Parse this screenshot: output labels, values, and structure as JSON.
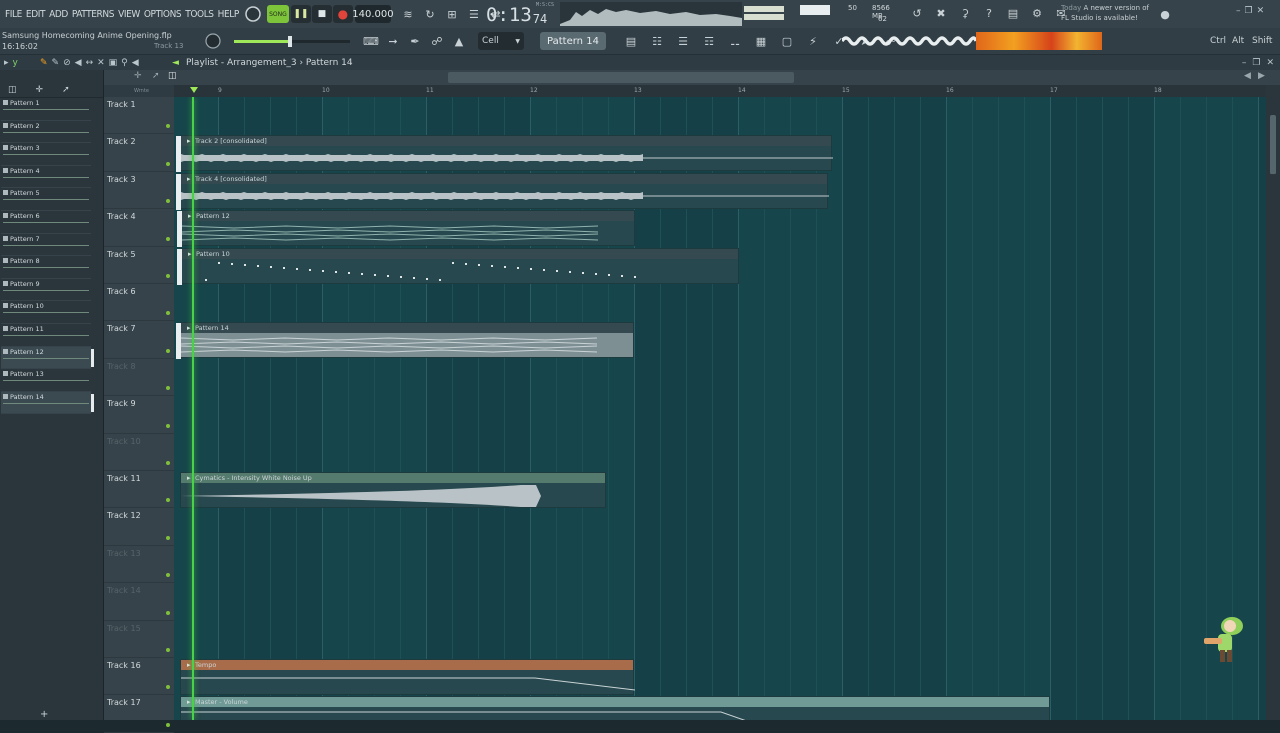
{
  "menu": [
    "FILE",
    "EDIT",
    "ADD",
    "PATTERNS",
    "VIEW",
    "OPTIONS",
    "TOOLS",
    "HELP"
  ],
  "transport": {
    "mode": "SONG",
    "tempo": "140.000"
  },
  "song": {
    "title": "Samsung Homecoming Anime Opening.flp",
    "time": "16:16:02",
    "track_hint": "Track 13"
  },
  "time": {
    "main": "0:13",
    "sub": "74",
    "unit": "M:S:CS"
  },
  "cpu": {
    "value": "50",
    "mem": "8566 MB",
    "poly": "62"
  },
  "news": {
    "today": "Today",
    "line1": "A newer version of",
    "line2": "FL Studio is available!"
  },
  "keys": {
    "ctrl": "Ctrl",
    "alt": "Alt",
    "shift": "Shift"
  },
  "snap": "Cell",
  "current_pattern": "Pattern 14",
  "breadcrumb": "Playlist - Arrangement_3 › Pattern 14",
  "ruler": [
    "9",
    "10",
    "11",
    "12",
    "13",
    "14",
    "15",
    "16",
    "17",
    "18"
  ],
  "ruler_small": "Wrnte",
  "patterns": [
    "Pattern 1",
    "Pattern 2",
    "Pattern 3",
    "Pattern 4",
    "Pattern 5",
    "Pattern 6",
    "Pattern 7",
    "Pattern 8",
    "Pattern 9",
    "Pattern 10",
    "Pattern 11",
    "Pattern 12",
    "Pattern 13",
    "Pattern 14"
  ],
  "tracks": [
    "Track 1",
    "Track 2",
    "Track 3",
    "Track 4",
    "Track 5",
    "Track 6",
    "Track 7",
    "Track 8",
    "Track 9",
    "Track 10",
    "Track 11",
    "Track 12",
    "Track 13",
    "Track 14",
    "Track 15",
    "Track 16",
    "Track 17"
  ],
  "clips": [
    "Track 2 [consolidated]",
    "Track 4 [consolidated]",
    "Pattern 12",
    "Pattern 10",
    "Pattern 14",
    "Cymatics - Intensity White Noise Up",
    "Tempo",
    "Master - Volume"
  ]
}
